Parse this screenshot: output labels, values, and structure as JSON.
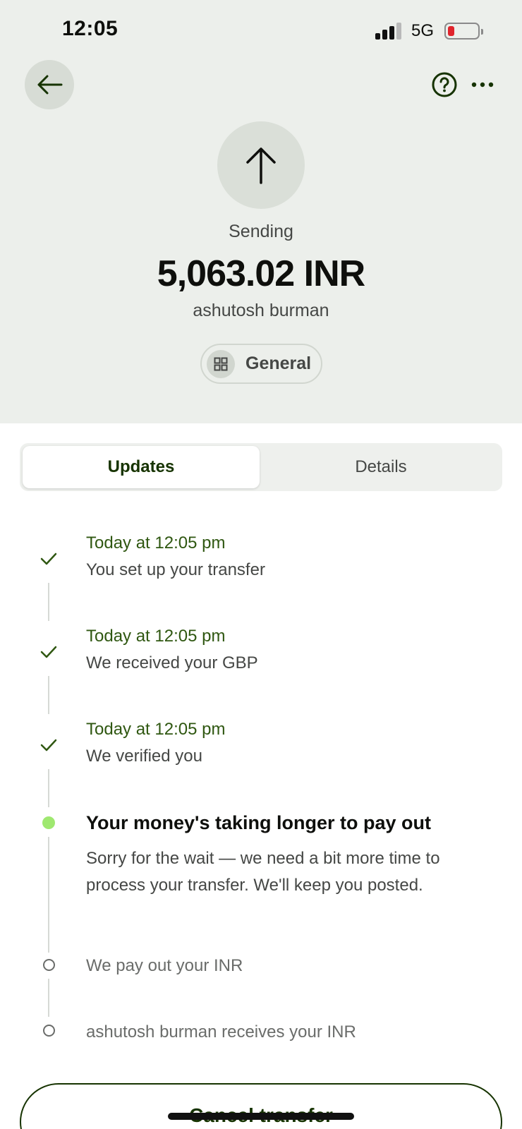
{
  "status_bar": {
    "time": "12:05",
    "network": "5G",
    "battery_level": 0.15,
    "battery_color": "#e0242c"
  },
  "header": {
    "back_icon": "arrow-left-icon",
    "help_icon": "question-circle-icon",
    "more_icon": "more-horizontal-icon"
  },
  "transfer": {
    "direction_icon": "arrow-up-icon",
    "status_label": "Sending",
    "amount": "5,063.02 INR",
    "recipient": "ashutosh burman",
    "category_icon": "grid-icon",
    "category_label": "General"
  },
  "tabs": [
    {
      "label": "Updates",
      "active": true
    },
    {
      "label": "Details",
      "active": false
    }
  ],
  "timeline": [
    {
      "state": "done",
      "time": "Today at 12:05 pm",
      "text": "You set up your transfer"
    },
    {
      "state": "done",
      "time": "Today at 12:05 pm",
      "text": "We received your GBP"
    },
    {
      "state": "done",
      "time": "Today at 12:05 pm",
      "text": "We verified you"
    },
    {
      "state": "current",
      "title": "Your money's taking longer to pay out",
      "body": "Sorry for the wait — we need a bit more time to process your transfer. We'll keep you posted."
    },
    {
      "state": "pending",
      "text": "We pay out your INR"
    },
    {
      "state": "pending",
      "text": "ashutosh burman receives your INR"
    }
  ],
  "actions": {
    "cancel_label": "Cancel transfer"
  },
  "colors": {
    "accent_green": "#9fe870",
    "forest_green": "#163300",
    "header_bg": "#ecefeb"
  }
}
